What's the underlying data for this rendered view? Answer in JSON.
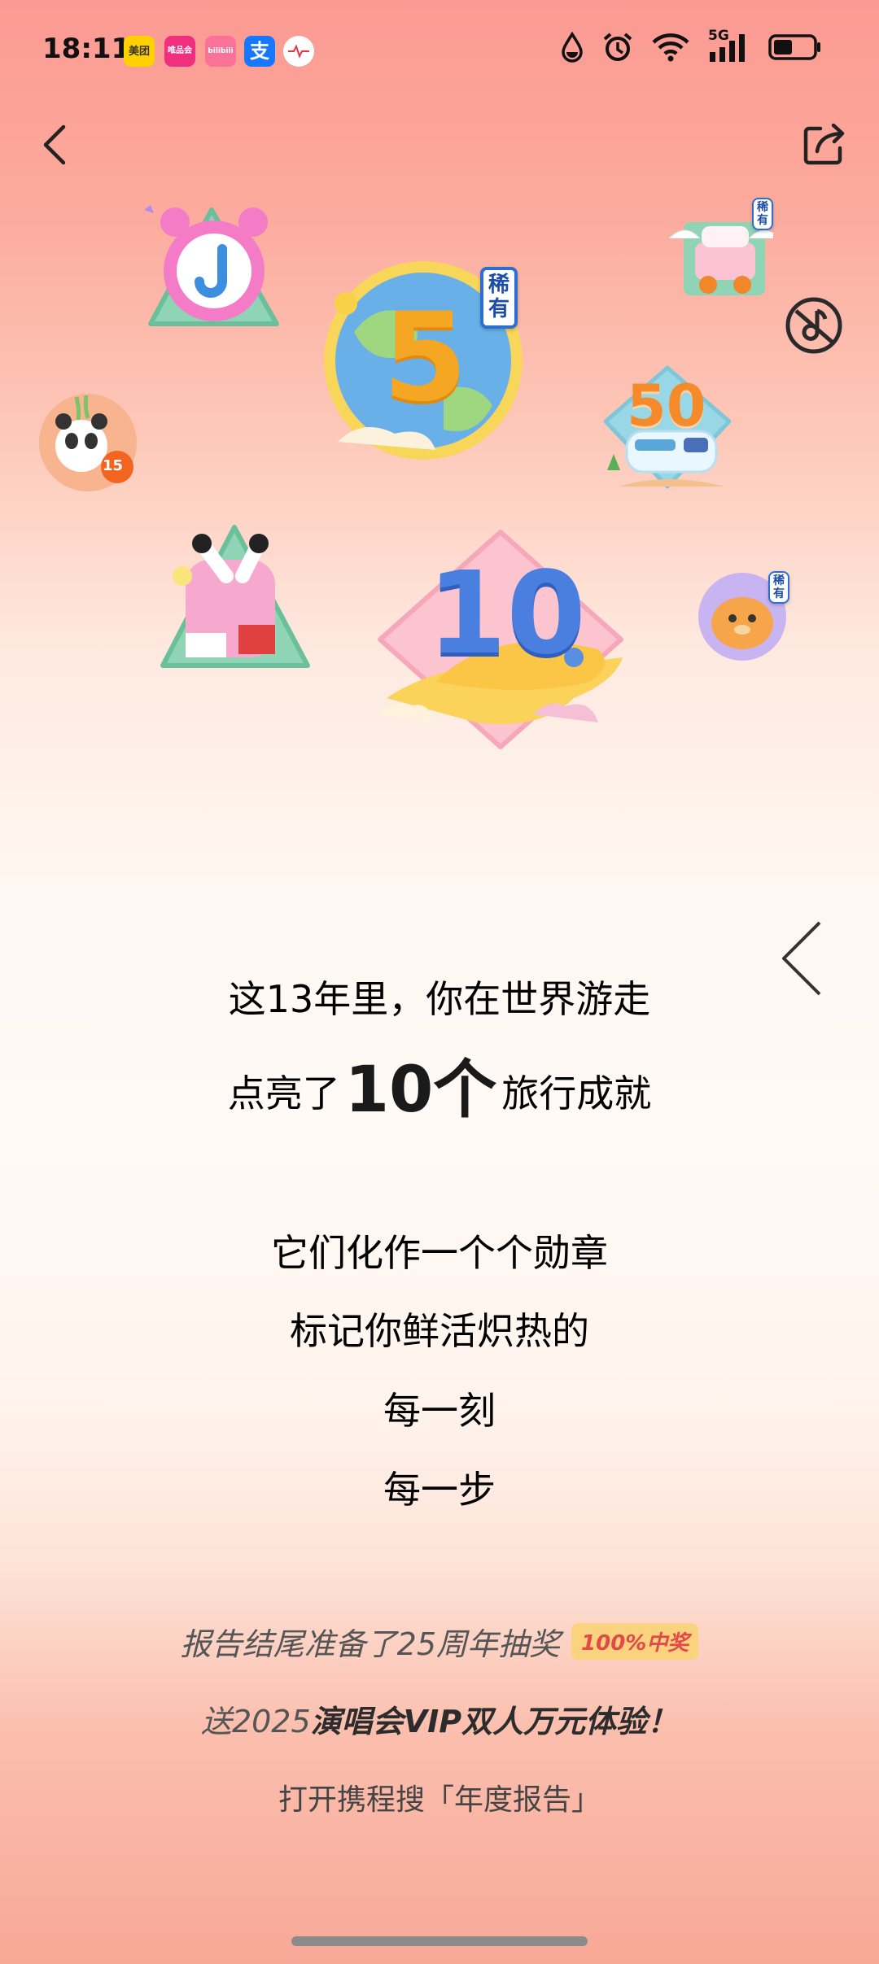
{
  "status_bar": {
    "time": "18:11",
    "notifications": [
      {
        "name": "meituan-app-icon",
        "text": "美团",
        "color": "#ffd100"
      },
      {
        "name": "vip-app-icon",
        "text": "唯品会",
        "color": "#f0307e"
      },
      {
        "name": "bilibili-app-icon",
        "text": "bilibili",
        "color": "#fb7299"
      },
      {
        "name": "alipay-app-icon",
        "text": "支",
        "color": "#1677ff"
      },
      {
        "name": "health-app-icon",
        "text": "",
        "color": "#ffffff"
      }
    ],
    "network": "5G"
  },
  "nav": {
    "back_icon": "chevron-left-icon",
    "share_icon": "share-icon"
  },
  "badges": {
    "rare_label": "稀有",
    "five_label": "5",
    "fifty_label": "50",
    "ten_label": "10",
    "panda_label": "15"
  },
  "report": {
    "line1": "这13年里，你在世界游走",
    "line2_prefix": "点亮了",
    "line2_count": "10个",
    "line2_suffix": "旅行成就",
    "line3": "它们化作一个个勋章",
    "line4": "标记你鲜活炽热的",
    "line5": "每一刻",
    "line6": "每一步"
  },
  "promo": {
    "line1": "报告结尾准备了25周年抽奖",
    "pill": "100%中奖",
    "line2_prefix": "送2025",
    "line2_bold": "演唱会VIP双人万元体验！",
    "hint": "打开携程搜「年度报告」"
  }
}
